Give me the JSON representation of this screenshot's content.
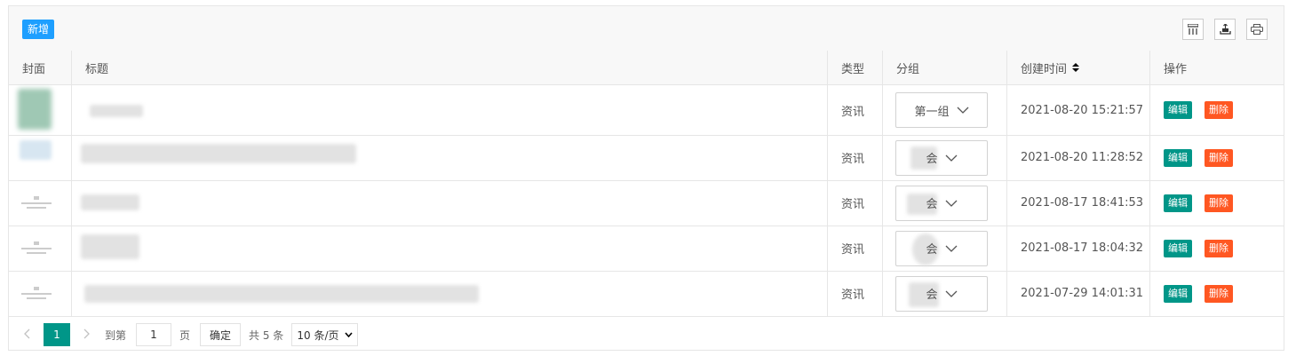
{
  "toolbar": {
    "add_label": "新增",
    "icons": [
      "columns-icon",
      "export-icon",
      "print-icon"
    ]
  },
  "table": {
    "headers": {
      "cover": "封面",
      "title": "标题",
      "type": "类型",
      "group": "分组",
      "created": "创建时间",
      "actions": "操作"
    },
    "rows": [
      {
        "type": "资讯",
        "group": "第一组",
        "created": "2021-08-20 15:21:57"
      },
      {
        "type": "资讯",
        "group": "会",
        "created": "2021-08-20 11:28:52"
      },
      {
        "type": "资讯",
        "group": "会",
        "created": "2021-08-17 18:41:53"
      },
      {
        "type": "资讯",
        "group": "会",
        "created": "2021-08-17 18:04:32"
      },
      {
        "type": "资讯",
        "group": "会",
        "created": "2021-07-29 14:01:31"
      }
    ],
    "edit_label": "编辑",
    "delete_label": "删除"
  },
  "pager": {
    "current_page": "1",
    "goto_prefix": "到第",
    "goto_value": "1",
    "goto_suffix": "页",
    "confirm_label": "确定",
    "total_label": "共 5 条",
    "page_size_label": "10 条/页"
  },
  "colors": {
    "add_button": "#1e9fff",
    "edit_button": "#009688",
    "delete_button": "#ff5722",
    "active_page": "#009688"
  }
}
